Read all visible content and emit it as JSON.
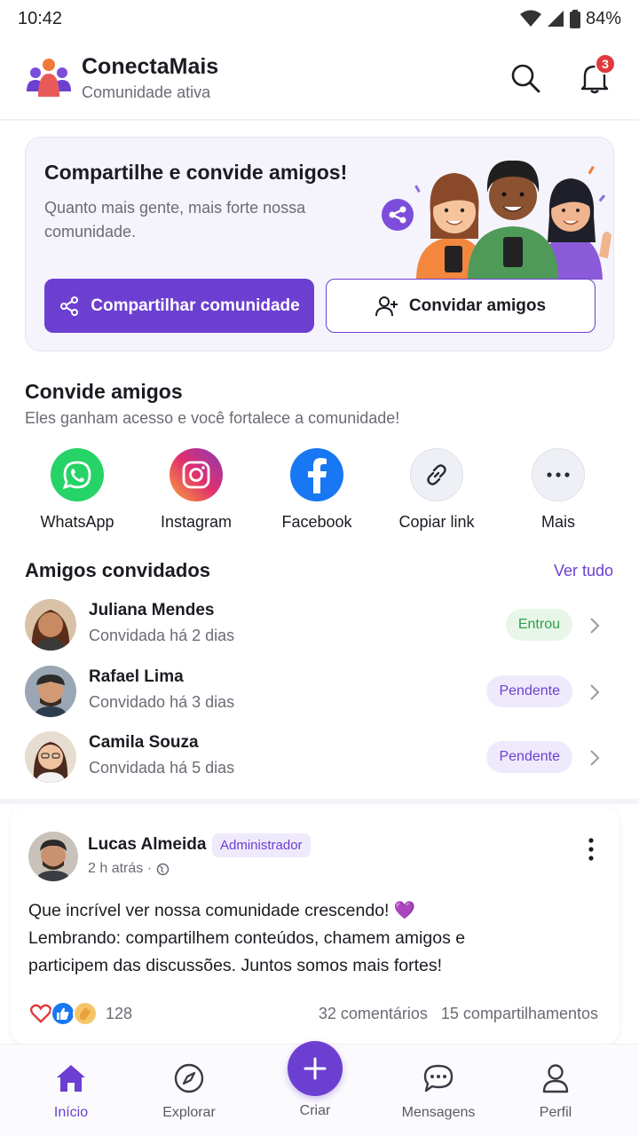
{
  "status_bar": {
    "time": "10:42",
    "battery": "84%"
  },
  "header": {
    "app_name": "ConectaMais",
    "subtitle": "Comunidade ativa",
    "notification_count": "3"
  },
  "share_card": {
    "title": "Compartilhe e convide amigos!",
    "description": "Quanto mais gente, mais forte nossa comunidade.",
    "share_button": "Compartilhar comunidade",
    "invite_button": "Convidar amigos"
  },
  "invite": {
    "title": "Convide amigos",
    "subtitle": "Eles ganham acesso e você fortalece a comunidade!",
    "targets": [
      {
        "label": "WhatsApp",
        "icon": "whatsapp-icon",
        "color": "#25D366"
      },
      {
        "label": "Instagram",
        "icon": "instagram-icon",
        "color": "#E1306C"
      },
      {
        "label": "Facebook",
        "icon": "facebook-icon",
        "color": "#1877F2"
      },
      {
        "label": "Copiar link",
        "icon": "link-icon",
        "color": "#EEF0F5"
      },
      {
        "label": "Mais",
        "icon": "more-icon",
        "color": "#EEF0F5"
      }
    ]
  },
  "friends": {
    "title": "Amigos convidados",
    "see_all": "Ver tudo",
    "items": [
      {
        "name": "Juliana Mendes",
        "sub": "Convidada há 2 dias",
        "status": "Entrou"
      },
      {
        "name": "Rafael Lima",
        "sub": "Convidado há 3 dias",
        "status": "Pendente"
      },
      {
        "name": "Camila Souza",
        "sub": "Convidada há 5 dias",
        "status": "Pendente"
      }
    ]
  },
  "post": {
    "author": "Lucas Almeida",
    "role": "Administrador",
    "time": "2 h atrás ·",
    "line1": "Que incrível ver nossa comunidade crescendo! 💜",
    "line2": "Lembrando: compartilhem conteúdos, chamem amigos e",
    "line3": "participem das discussões. Juntos somos mais fortes!",
    "reaction_count": "128",
    "comments": "32 comentários",
    "shares": "15 compartilhamentos"
  },
  "nav": {
    "home": "Início",
    "explore": "Explorar",
    "create": "Criar",
    "messages": "Mensagens",
    "profile": "Perfil"
  },
  "colors": {
    "accent": "#6C3FD1",
    "joined": "#2E9D48",
    "badge": "#E0393E"
  }
}
